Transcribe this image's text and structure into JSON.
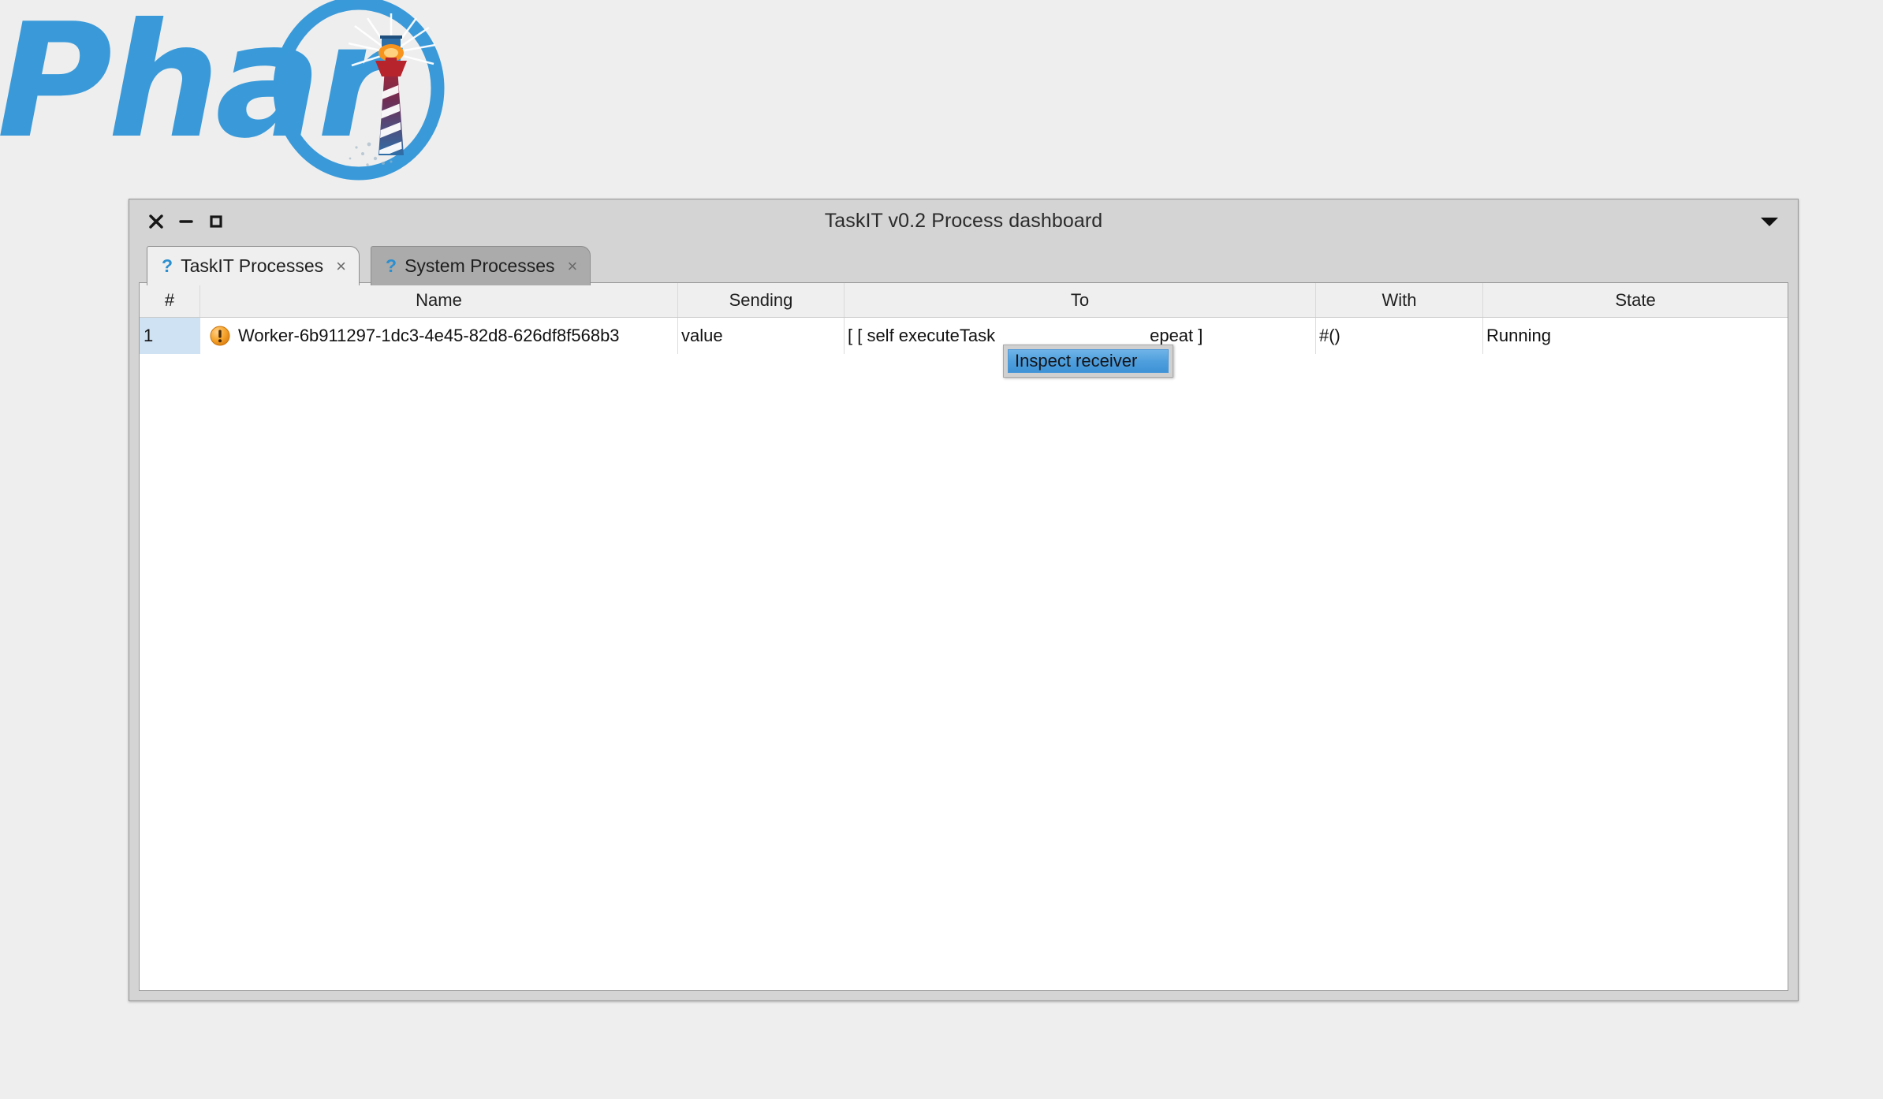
{
  "logo": {
    "wordmark": "Phar",
    "mark_name": "lighthouse-in-circle",
    "brand_color": "#3a9ad9"
  },
  "window": {
    "title": "TaskIT v0.2 Process dashboard",
    "controls": {
      "close": "×",
      "minimize": "−",
      "maximize": "□"
    },
    "title_menu_icon": "chevron-down-icon",
    "tabs_menu_icon": "chevron-down-icon"
  },
  "tabs": [
    {
      "icon": "?",
      "label": "TaskIT Processes",
      "close": "×",
      "active": true
    },
    {
      "icon": "?",
      "label": "System Processes",
      "close": "×",
      "active": false
    }
  ],
  "table": {
    "columns": [
      "#",
      "Name",
      "Sending",
      "To",
      "With",
      "State"
    ],
    "rows": [
      {
        "index": "1",
        "status_icon": "warning-icon",
        "name": "Worker-6b911297-1dc3-4e45-82d8-626df8f568b3",
        "sending": "value",
        "to_prefix": "[ [ self executeTask",
        "to_suffix": "epeat ]",
        "with": "#()",
        "state": "Running",
        "selected": true
      }
    ]
  },
  "context_menu": {
    "items": [
      {
        "label": "Inspect receiver",
        "highlighted": true
      }
    ]
  },
  "colors": {
    "accent_blue": "#3a9ad9",
    "selection_blue": "#cfe2f3",
    "menu_highlight": "#4f9fdd",
    "warning_orange": "#f0941e",
    "window_chrome": "#d4d4d4",
    "desktop": "#eeeeee"
  }
}
